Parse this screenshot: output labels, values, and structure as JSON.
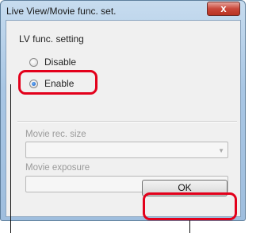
{
  "dialog": {
    "title": "Live View/Movie func. set.",
    "close_label": "x",
    "lv_group_label": "LV func. setting",
    "options": [
      {
        "label": "Disable",
        "selected": false
      },
      {
        "label": "Enable",
        "selected": true
      }
    ],
    "movie_rec_size_label": "Movie rec. size",
    "movie_rec_size_value": "",
    "movie_exposure_label": "Movie exposure",
    "movie_exposure_value": "",
    "ok_label": "OK"
  },
  "colors": {
    "callout": "#e3001b",
    "title_bar": "#a8c6e4",
    "close_button": "#c9473a"
  }
}
